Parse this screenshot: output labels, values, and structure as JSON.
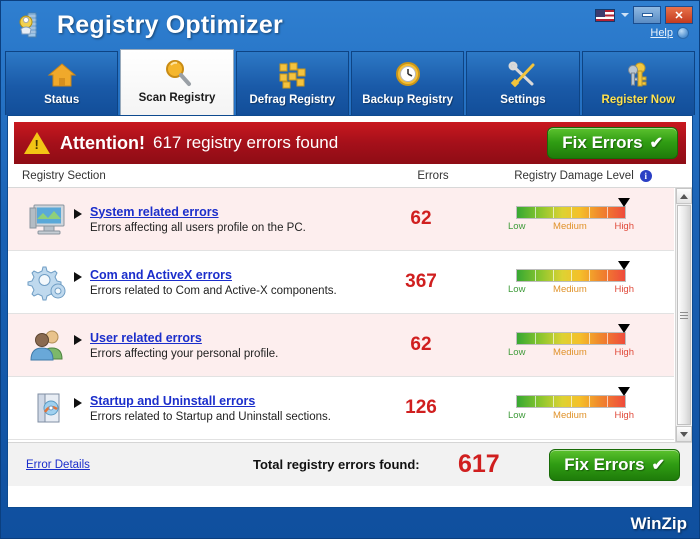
{
  "window": {
    "title": "Registry Optimizer",
    "app_icon": "registry-optimizer-icon",
    "language_flag": "us-flag-icon",
    "minimize_label": "",
    "close_label": "✕",
    "help_label": "Help"
  },
  "tabs": [
    {
      "label": "Status",
      "icon": "home-icon",
      "active": false,
      "accent": false
    },
    {
      "label": "Scan Registry",
      "icon": "magnifier-icon",
      "active": true,
      "accent": false
    },
    {
      "label": "Defrag Registry",
      "icon": "blocks-icon",
      "active": false,
      "accent": false
    },
    {
      "label": "Backup Registry",
      "icon": "clock-icon",
      "active": false,
      "accent": false
    },
    {
      "label": "Settings",
      "icon": "tools-icon",
      "active": false,
      "accent": false
    },
    {
      "label": "Register Now",
      "icon": "keys-icon",
      "active": false,
      "accent": true
    }
  ],
  "banner": {
    "icon": "warning-triangle-icon",
    "strong": "Attention!",
    "message": "617 registry errors found",
    "fix_button": "Fix Errors",
    "check": "✔"
  },
  "table": {
    "headers": {
      "section": "Registry Section",
      "errors": "Errors",
      "damage": "Registry Damage Level",
      "info_icon": "info-icon"
    },
    "gauge_labels": {
      "low": "Low",
      "medium": "Medium",
      "high": "High"
    },
    "rows": [
      {
        "icon": "monitor-icon",
        "title": "System related errors",
        "desc": "Errors affecting all users profile on the PC.",
        "errors": "62",
        "damage": "High"
      },
      {
        "icon": "gears-icon",
        "title": "Com and ActiveX errors",
        "desc": "Errors related to Com and Active-X components.",
        "errors": "367",
        "damage": "High"
      },
      {
        "icon": "users-icon",
        "title": "User related errors",
        "desc": "Errors affecting your personal profile.",
        "errors": "62",
        "damage": "High"
      },
      {
        "icon": "startup-book-icon",
        "title": "Startup and Uninstall errors",
        "desc": "Errors related to Startup and Uninstall sections.",
        "errors": "126",
        "damage": "High"
      }
    ]
  },
  "footer": {
    "error_details": "Error Details",
    "total_label": "Total registry errors found:",
    "total_value": "617",
    "fix_button": "Fix Errors",
    "check": "✔"
  },
  "statusbar": {
    "brand": "WinZip"
  },
  "colors": {
    "banner_red": "#a5101a",
    "fix_green": "#2f9c13",
    "error_red": "#d01f1f",
    "link_blue": "#1b2ecb",
    "tab_blue": "#1a5aa8",
    "accent_yellow": "#ffe24d"
  }
}
